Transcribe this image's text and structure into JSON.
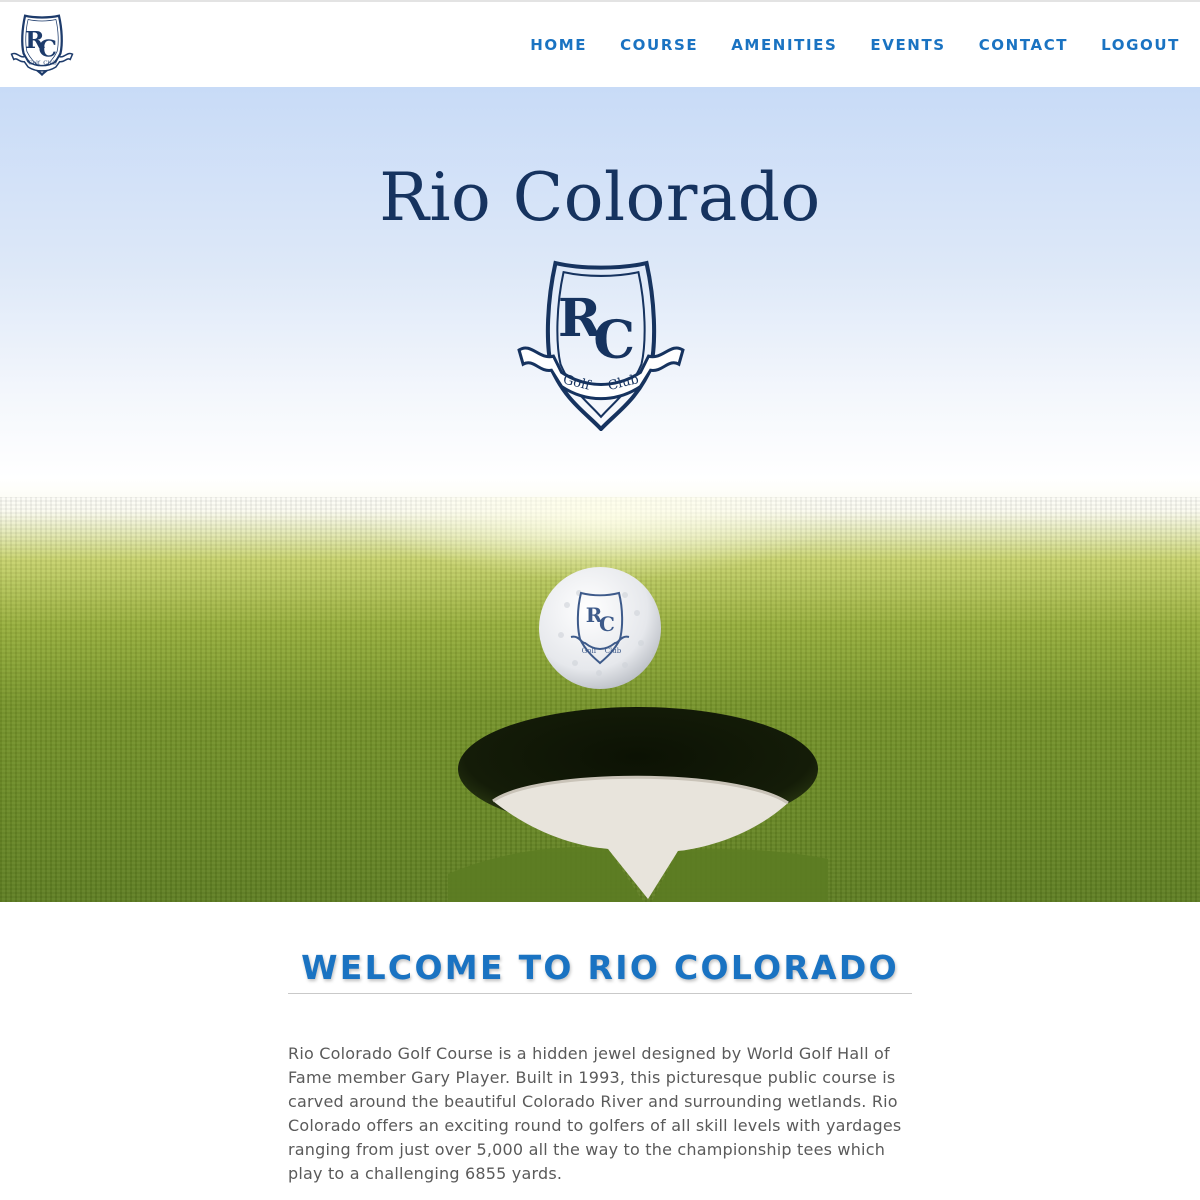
{
  "header": {
    "logo": {
      "icon": "rc-golf-club-crest-icon",
      "monogram": "RC",
      "ribbon_left": "Golf",
      "ribbon_right": "Club"
    },
    "nav": [
      {
        "label": "HOME"
      },
      {
        "label": "COURSE"
      },
      {
        "label": "AMENITIES"
      },
      {
        "label": "EVENTS"
      },
      {
        "label": "CONTACT"
      },
      {
        "label": "LOGOUT"
      }
    ]
  },
  "hero": {
    "title": "Rio Colorado",
    "crest": {
      "monogram": "RC",
      "ribbon_left": "Golf",
      "ribbon_right": "Club"
    },
    "image": "golf-ball-at-hole-on-green"
  },
  "welcome": {
    "heading": "WELCOME TO RIO COLORADO",
    "body": "Rio Colorado Golf Course is a hidden jewel designed by World Golf Hall of Fame member Gary Player. Built in 1993, this picturesque public course is carved around the beautiful Colorado River and surrounding wetlands. Rio Colorado offers an exciting round to golfers of all skill levels with yardages ranging from just over 5,000 all the way to the championship tees which play to a challenging 6855 yards."
  },
  "colors": {
    "brand_navy": "#16335f",
    "accent_blue": "#1a73c2",
    "body_text": "#5a5a5a"
  }
}
